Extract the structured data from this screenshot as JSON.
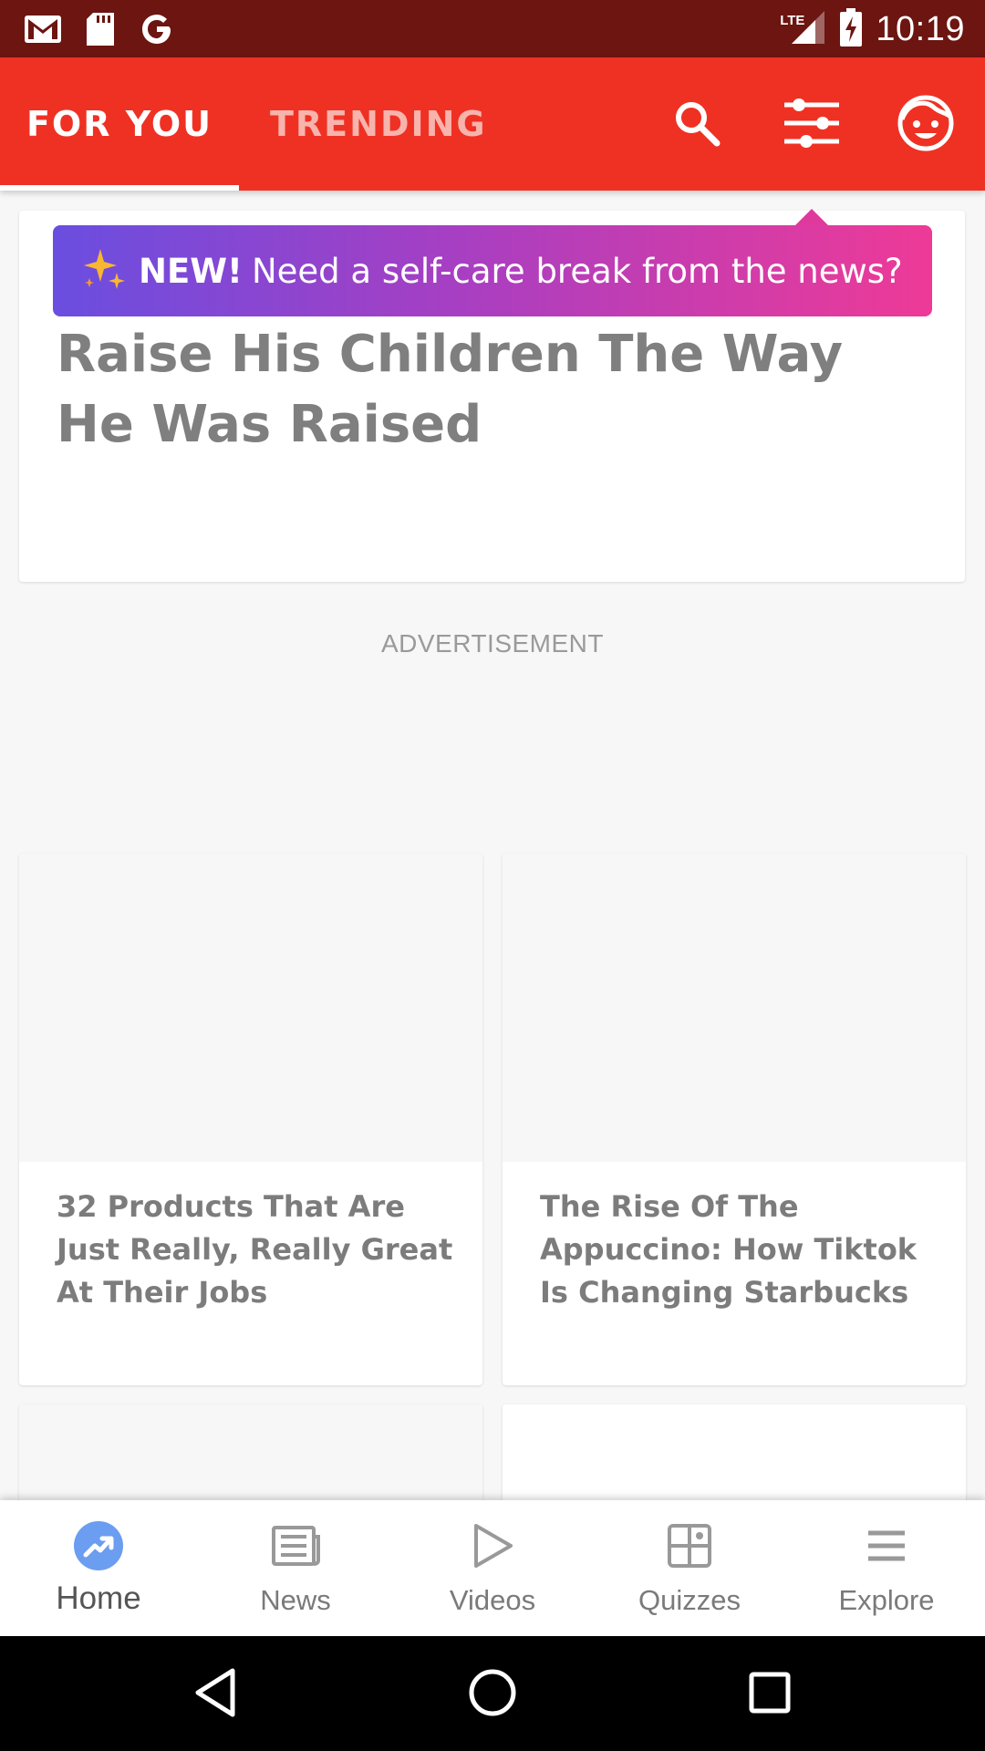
{
  "status_bar": {
    "time": "10:19",
    "network": "LTE",
    "icons": [
      "gmail-icon",
      "sd-card-icon",
      "google-icon",
      "signal-icon",
      "battery-charging-icon"
    ]
  },
  "app_bar": {
    "tabs": [
      {
        "label": "FOR YOU",
        "active": true
      },
      {
        "label": "TRENDING",
        "active": false
      }
    ],
    "actions": [
      "search-icon",
      "filter-sliders-icon",
      "profile-face-icon"
    ],
    "brand_color": "#ef3124"
  },
  "promo": {
    "new_label": "NEW!",
    "message": "Need a self-care break from the news?",
    "gradient": [
      "#6a4ee0",
      "#ee3a97"
    ]
  },
  "feature_article": {
    "title": "Raise His Children The Way He Was Raised"
  },
  "ad": {
    "label": "ADVERTISEMENT"
  },
  "articles": [
    {
      "title": "32 Products That Are Just Really, Really Great At Their Jobs"
    },
    {
      "title": "The Rise Of The Appuccino: How Tiktok Is Changing Starbucks"
    }
  ],
  "bottom_nav": {
    "items": [
      {
        "label": "Home",
        "icon": "trending-arrow-icon",
        "active": true
      },
      {
        "label": "News",
        "icon": "newspaper-icon",
        "active": false
      },
      {
        "label": "Videos",
        "icon": "play-icon",
        "active": false
      },
      {
        "label": "Quizzes",
        "icon": "quiz-grid-icon",
        "active": false
      },
      {
        "label": "Explore",
        "icon": "menu-icon",
        "active": false
      }
    ],
    "active_color": "#6b9df0"
  },
  "system_nav": [
    "back-icon",
    "home-circle-icon",
    "recents-square-icon"
  ]
}
